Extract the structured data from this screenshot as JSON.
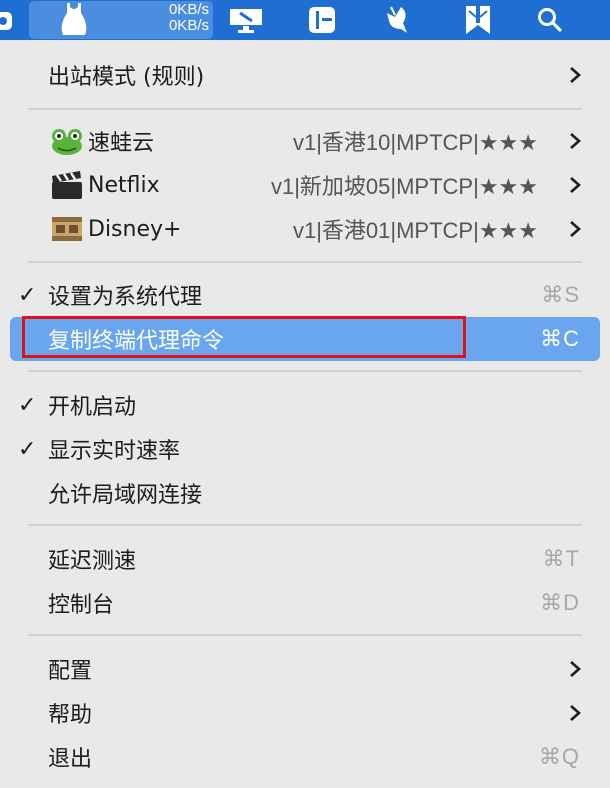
{
  "status": {
    "upload_speed": "0KB/s",
    "download_speed": "0KB/s"
  },
  "menubar_icons": [
    "app-icon",
    "network-status-icon",
    "display-icon",
    "layout-icon",
    "bird-icon",
    "bookmark-icon",
    "search-icon"
  ],
  "menu": {
    "outbound_mode": "出站模式 (规则)",
    "proxies": [
      {
        "name": "速蛙云",
        "detail": "v1|香港10|MPTCP|★★★",
        "icon": "frog-icon"
      },
      {
        "name": "Netflix",
        "detail": "v1|新加坡05|MPTCP|★★★",
        "icon": "clapperboard-icon"
      },
      {
        "name": "Disney+",
        "detail": "v1|香港01|MPTCP|★★★",
        "icon": "film-reel-icon"
      }
    ],
    "set_system_proxy": {
      "label": "设置为系统代理",
      "shortcut": "⌘S",
      "checked": true
    },
    "copy_terminal_proxy": {
      "label": "复制终端代理命令",
      "shortcut": "⌘C"
    },
    "launch_at_login": {
      "label": "开机启动",
      "checked": true
    },
    "show_speed": {
      "label": "显示实时速率",
      "checked": true
    },
    "allow_lan": {
      "label": "允许局域网连接"
    },
    "latency_test": {
      "label": "延迟测速",
      "shortcut": "⌘T"
    },
    "console": {
      "label": "控制台",
      "shortcut": "⌘D"
    },
    "config": {
      "label": "配置"
    },
    "help": {
      "label": "帮助"
    },
    "quit": {
      "label": "退出",
      "shortcut": "⌘Q"
    },
    "check_glyph": "✓"
  },
  "colors": {
    "menubar": "#1f6fd3",
    "highlight": "#6aa6ef",
    "annotation": "#e01414"
  }
}
